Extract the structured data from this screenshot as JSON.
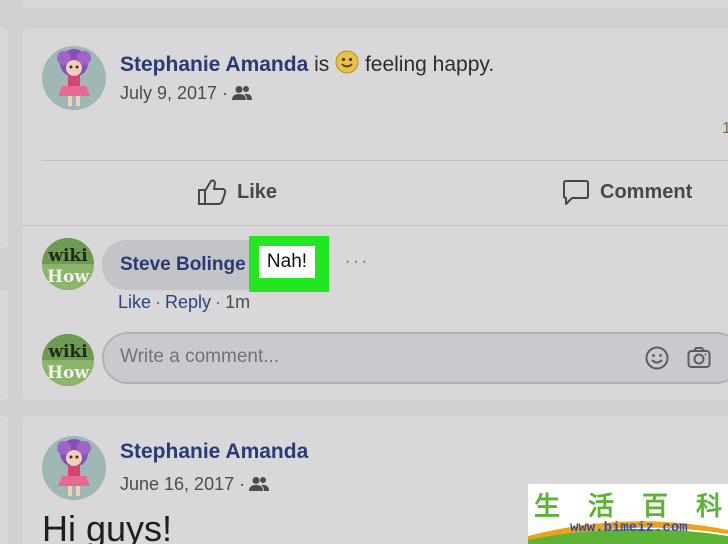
{
  "post1": {
    "author": "Stephanie Amanda",
    "status_text": " is ",
    "feeling_text": " feeling happy.",
    "date": "July 9, 2017 ·",
    "reaction_count": "1",
    "like_label": "Like",
    "comment_label": "Comment"
  },
  "comment": {
    "author": "Steve Bolinge",
    "text": "Nah!",
    "more": "···",
    "like_label": "Like",
    "reply_label": "Reply",
    "separator": "·",
    "time": "1m"
  },
  "composer": {
    "placeholder": "Write a comment..."
  },
  "post2": {
    "author": "Stephanie Amanda",
    "date": "June 16, 2017 ·",
    "text": "Hi guys!"
  },
  "watermark": {
    "chars": [
      "生",
      "活",
      "百",
      "科"
    ],
    "url": "www.bimeiz.com"
  },
  "colors": {
    "name_blue": "#2a3b74",
    "highlight_green": "#22e61f",
    "card_gray": "#d8d8da"
  }
}
